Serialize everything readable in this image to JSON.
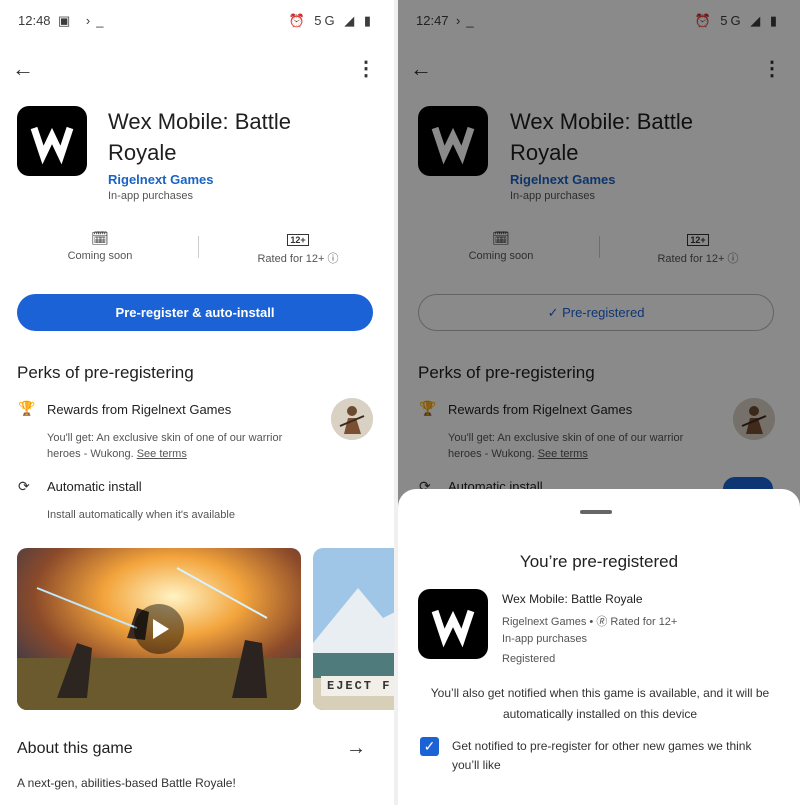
{
  "left": {
    "status": {
      "time": "12:48",
      "icons": "▣ ›_",
      "right": "⏰ 5G ◢ ▮"
    },
    "app": {
      "title": "Wex Mobile: Battle Royale",
      "developer": "Rigelnext Games",
      "iap": "In-app purchases"
    },
    "stats": {
      "coming": "Coming soon",
      "rating_badge": "12+",
      "rated": "Rated for 12+ ⓘ"
    },
    "cta": "Pre-register & auto-install",
    "perks": {
      "heading": "Perks of pre-registering",
      "rewards_title": "Rewards from Rigelnext Games",
      "rewards_desc": "You'll get: An exclusive skin of one of our warrior heroes - Wukong.",
      "see_terms": "See terms",
      "auto_title": "Automatic install",
      "auto_desc": "Install automatically when it's available"
    },
    "screenshot2_text": "EJECT F",
    "about": {
      "heading": "About this game",
      "desc": "A next-gen, abilities-based Battle Royale!"
    }
  },
  "right": {
    "status": {
      "time": "12:47",
      "icons": "›_",
      "right": "⏰ 5G ◢ ▮"
    },
    "app": {
      "title": "Wex Mobile: Battle Royale",
      "developer": "Rigelnext Games",
      "iap": "In-app purchases"
    },
    "stats": {
      "coming": "Coming soon",
      "rating_badge": "12+",
      "rated": "Rated for 12+ ⓘ"
    },
    "cta": "✓ Pre-registered",
    "perks": {
      "heading": "Perks of pre-registering",
      "rewards_title": "Rewards from Rigelnext Games",
      "rewards_desc": "You'll get: An exclusive skin of one of our warrior heroes - Wukong.",
      "see_terms": "See terms",
      "auto_title": "Automatic install"
    },
    "sheet": {
      "title": "You’re pre-registered",
      "app_name": "Wex Mobile: Battle Royale",
      "meta_line": "Rigelnext Games • 🄬 Rated for 12+",
      "iap": "In-app purchases",
      "registered": "Registered",
      "notice": "You’ll also get notified when this game is available, and it will be automatically installed on this device",
      "checkbox_label": "Get notified to pre-register for other new games we think you’ll like",
      "checkbox_checked": true
    }
  },
  "colors": {
    "accent": "#1a62d6",
    "link": "#1a63c4"
  }
}
